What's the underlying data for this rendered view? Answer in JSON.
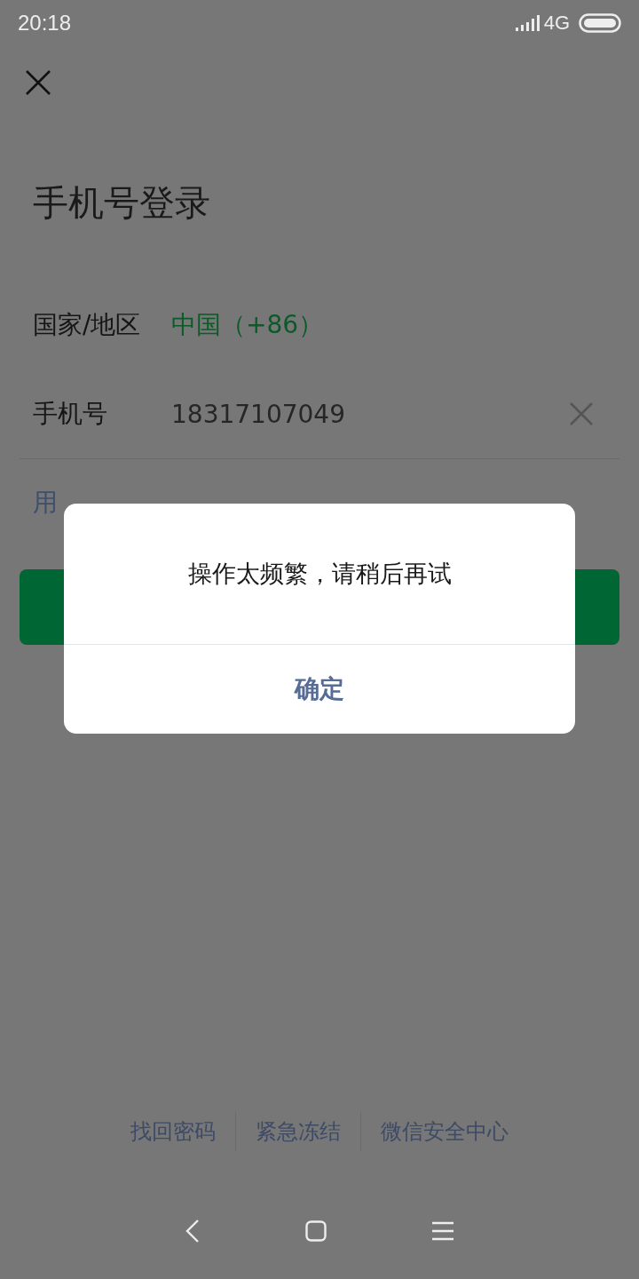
{
  "status_bar": {
    "time": "20:18",
    "network": "4G"
  },
  "title": "手机号登录",
  "country": {
    "label": "国家/地区",
    "value": "中国（+86）"
  },
  "phone": {
    "label": "手机号",
    "value": "18317107049"
  },
  "alt_login_link": "用",
  "dialog": {
    "message": "操作太频繁，请稍后再试",
    "button": "确定"
  },
  "footer_links": [
    "找回密码",
    "紧急冻结",
    "微信安全中心"
  ]
}
